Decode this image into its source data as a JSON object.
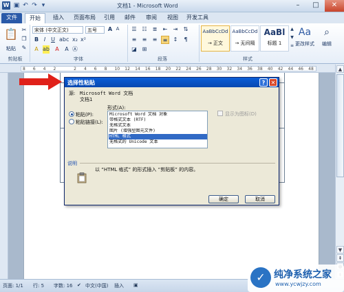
{
  "window": {
    "app_icon": "W",
    "title": "文档1 - Microsoft Word"
  },
  "quick_access": [
    "save-icon",
    "undo-icon",
    "redo-icon"
  ],
  "tabs": [
    "文件",
    "开始",
    "插入",
    "页面布局",
    "引用",
    "邮件",
    "审阅",
    "视图",
    "开发工具"
  ],
  "ribbon": {
    "paste_label": "粘贴",
    "font_name": "宋体 (中文正文)",
    "font_size": "五号",
    "styles": [
      {
        "sample": "AaBbCcDd",
        "name": "→ 正文"
      },
      {
        "sample": "AaBbCcDd",
        "name": "→ 无间隔"
      },
      {
        "sample": "AaBl",
        "name": "标题 1"
      }
    ],
    "change_styles": "更改样式",
    "edit": "编辑",
    "groups": [
      "剪贴板",
      "字体",
      "段落",
      "样式"
    ]
  },
  "ruler": {
    "marks": [
      "8",
      "6",
      "4",
      "2",
      "",
      "2",
      "4",
      "6",
      "8",
      "10",
      "12",
      "14",
      "16",
      "18",
      "20",
      "22",
      "24",
      "26",
      "28",
      "30",
      "32",
      "34",
      "36",
      "38",
      "40",
      "42",
      "44",
      "46",
      "48"
    ]
  },
  "dialog": {
    "title": "选择性粘贴",
    "source_label": "源:",
    "source_value": "Microsoft Word 文档",
    "source_doc": "文档1",
    "format_label": "形式(A):",
    "options": [
      {
        "label": "粘贴(P):",
        "selected": true
      },
      {
        "label": "粘贴链接(L):",
        "selected": false
      }
    ],
    "formats": [
      "Microsoft Word 文档 对象",
      "带格式文本 (RTF)",
      "无格式文本",
      "图片 (增强型图元文件)",
      "HTML 格式",
      "无格式的 Unicode 文本"
    ],
    "selected_format_index": 4,
    "show_as_icon": "显示为图标(D)",
    "description_label": "说明",
    "description_text": "以 “HTML 格式” 的形式插入 “剪贴板” 的内容。",
    "ok_label": "确定",
    "cancel_label": "取消"
  },
  "status": {
    "page": "页面: 1/1",
    "row": "行: 5",
    "words": "字数: 16",
    "lang": "中文(中国)",
    "mode": "插入"
  },
  "watermark": {
    "title": "纯净系统之家",
    "url": "www.ycwjzy.com"
  },
  "colors": {
    "accent": "#2a5aa8",
    "selection": "#316ac5",
    "arrow": "#e0211a"
  }
}
